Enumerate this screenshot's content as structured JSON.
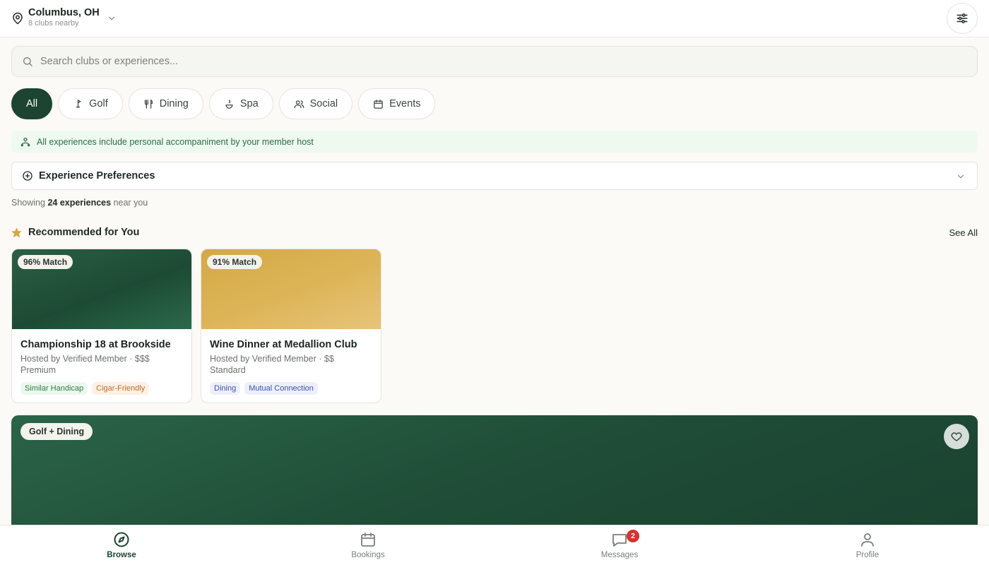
{
  "header": {
    "city": "Columbus, OH",
    "clubs_nearby": "8 clubs nearby"
  },
  "search": {
    "placeholder": "Search clubs or experiences..."
  },
  "categories": [
    {
      "label": "All",
      "active": true
    },
    {
      "label": "Golf",
      "icon": "golf-icon"
    },
    {
      "label": "Dining",
      "icon": "utensils-icon"
    },
    {
      "label": "Spa",
      "icon": "spa-icon"
    },
    {
      "label": "Social",
      "icon": "users-icon"
    },
    {
      "label": "Events",
      "icon": "calendar-icon"
    }
  ],
  "notice": {
    "text": "All experiences include personal accompaniment by your member host",
    "icon": "host-icon"
  },
  "preferences": {
    "title": "Experience Preferences"
  },
  "results": {
    "prefix": "Showing",
    "count": "24 experiences",
    "suffix": "near you"
  },
  "recommended": {
    "title": "Recommended for You",
    "see_all": "See All",
    "cards": [
      {
        "match": "96% Match",
        "title": "Championship 18 at Brookside",
        "host": "Hosted by Verified Member · $$$",
        "tier": "Premium",
        "tags": [
          "Similar Handicap",
          "Cigar-Friendly"
        ]
      },
      {
        "match": "91% Match",
        "title": "Wine Dinner at Medallion Club",
        "host": "Hosted by Verified Member · $$",
        "tier": "Standard",
        "tags": [
          "Dining",
          "Mutual Connection"
        ]
      }
    ]
  },
  "feature": {
    "badge": "Golf + Dining"
  },
  "nav": {
    "items": [
      {
        "label": "Browse",
        "icon": "compass-icon",
        "active": true
      },
      {
        "label": "Bookings",
        "icon": "calendar-icon"
      },
      {
        "label": "Messages",
        "icon": "message-icon",
        "badge": "2"
      },
      {
        "label": "Profile",
        "icon": "user-icon"
      }
    ]
  },
  "colors": {
    "brand": "#1c4430",
    "notice_bg": "#eefaf0",
    "badge_red": "#d8322c",
    "gold": "#d4a944"
  }
}
